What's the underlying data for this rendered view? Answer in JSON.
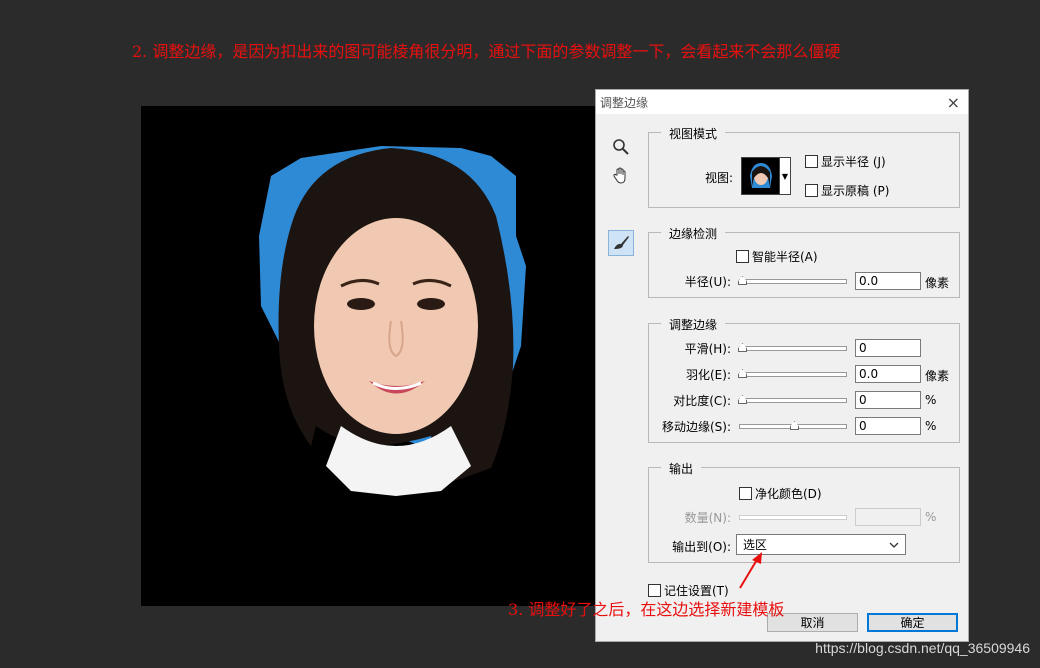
{
  "notes": {
    "top": "2. 调整边缘，是因为扣出来的图可能棱角很分明，通过下面的参数调整一下，会看起来不会那么僵硬",
    "bottom": "3. 调整好了之后，在这边选择新建模板"
  },
  "dialog": {
    "title": "调整边缘",
    "close": "×",
    "view_mode": {
      "title": "视图模式",
      "view_label": "视图:",
      "show_radius": "显示半径 (J)",
      "show_original": "显示原稿 (P)"
    },
    "edge_detection": {
      "title": "边缘检测",
      "smart_radius": "智能半径(A)",
      "radius_label": "半径(U):",
      "radius_value": "0.0",
      "radius_unit": "像素"
    },
    "adjust_edge": {
      "title": "调整边缘",
      "smooth_label": "平滑(H):",
      "smooth_value": "0",
      "feather_label": "羽化(E):",
      "feather_value": "0.0",
      "feather_unit": "像素",
      "contrast_label": "对比度(C):",
      "contrast_value": "0",
      "contrast_unit": "%",
      "shift_label": "移动边缘(S):",
      "shift_value": "0",
      "shift_unit": "%"
    },
    "output": {
      "title": "输出",
      "decontaminate": "净化颜色(D)",
      "amount_label": "数量(N):",
      "amount_unit": "%",
      "output_to_label": "输出到(O):",
      "output_to_value": "选区"
    },
    "remember": "记住设置(T)",
    "cancel": "取消",
    "ok": "确定"
  },
  "watermark": "https://blog.csdn.net/qq_36509946",
  "colors": {
    "annotation": "#e8100f",
    "selection_fill": "#2f8ad6",
    "primary_border": "#0078d7"
  }
}
